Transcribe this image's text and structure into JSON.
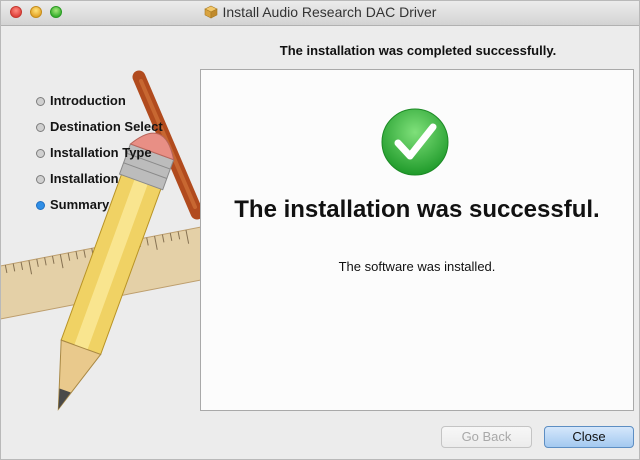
{
  "window": {
    "title": "Install Audio Research DAC Driver",
    "title_icon": "package-icon"
  },
  "header": {
    "subtitle": "The installation was completed successfully."
  },
  "sidebar": {
    "items": [
      {
        "label": "Introduction",
        "state": "done"
      },
      {
        "label": "Destination Select",
        "state": "done"
      },
      {
        "label": "Installation Type",
        "state": "done"
      },
      {
        "label": "Installation",
        "state": "done"
      },
      {
        "label": "Summary",
        "state": "current"
      }
    ]
  },
  "main": {
    "status_icon": "checkmark-circle-icon",
    "headline": "The installation was successful.",
    "detail": "The software was installed."
  },
  "buttons": {
    "back_label": "Go Back",
    "back_enabled": false,
    "close_label": "Close",
    "close_default": true
  },
  "colors": {
    "accent": "#2f8ee6",
    "success_green": "#3cb93f"
  }
}
